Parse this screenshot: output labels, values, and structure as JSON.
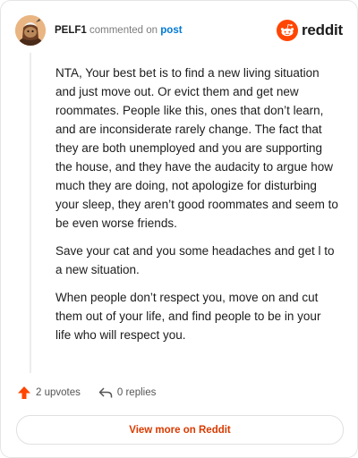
{
  "comment": {
    "author": "PELF1",
    "action_text": "commented on",
    "post_link": "post",
    "paragraphs": [
      "NTA, Your best bet is to find a new living situation and just move out. Or evict them and get new roommates. People like this, ones that don’t learn, and are inconsiderate rarely change. The fact that they are both unemployed and you are supporting the house, and they have the audacity to argue how much they are doing, not apologize for disturbing your sleep, they aren’t good roommates and seem to be even worse friends.",
      "Save your cat and you some headaches and get l to a new situation.",
      "When people don’t respect you, move on and cut them out of your life, and find people to be in your life who will respect you."
    ]
  },
  "brand": {
    "name": "reddit",
    "icon": "reddit-snoo-icon",
    "color": "#ff4500"
  },
  "actions": {
    "upvotes": "2 upvotes",
    "upvote_icon": "upvote-arrow-icon",
    "upvote_color": "#ff4500",
    "replies": "0 replies",
    "reply_icon": "reply-arrow-icon"
  },
  "view_button": {
    "label": "View more on Reddit",
    "color": "#d93a00"
  },
  "avatar": {
    "icon": "user-avatar-snoo"
  }
}
